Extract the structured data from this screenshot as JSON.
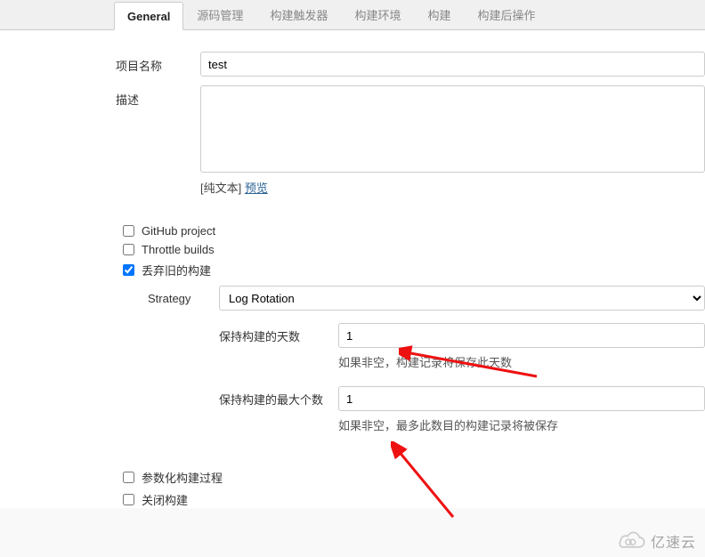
{
  "tabs": {
    "general": "General",
    "scm": "源码管理",
    "triggers": "构建触发器",
    "env": "构建环境",
    "build": "构建",
    "post": "构建后操作"
  },
  "fields": {
    "projectNameLabel": "项目名称",
    "projectNameValue": "test",
    "descriptionLabel": "描述",
    "descriptionValue": "",
    "plainTextPrefix": "[纯文本] ",
    "previewLink": "预览"
  },
  "checks": {
    "github": "GitHub project",
    "throttle": "Throttle builds",
    "discard": "丢弃旧的构建",
    "param": "参数化构建过程",
    "close": "关闭构建"
  },
  "strategy": {
    "label": "Strategy",
    "value": "Log Rotation"
  },
  "retain": {
    "daysLabel": "保持构建的天数",
    "daysValue": "1",
    "daysHint": "如果非空，构建记录将保存此天数",
    "maxLabel": "保持构建的最大个数",
    "maxValue": "1",
    "maxHint": "如果非空，最多此数目的构建记录将被保存"
  },
  "watermark": "亿速云"
}
